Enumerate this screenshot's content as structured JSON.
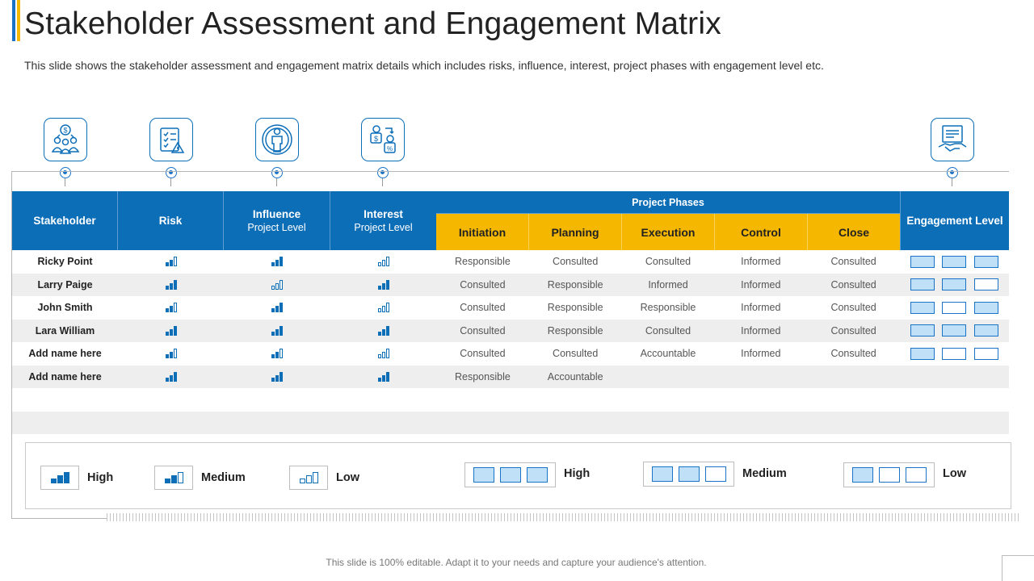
{
  "title": "Stakeholder Assessment and Engagement Matrix",
  "subtitle": "This slide shows the stakeholder assessment and engagement matrix details which includes risks, influence, interest, project phases with engagement level etc.",
  "colors": {
    "blue": "#0d6eb8",
    "yellow": "#f5b700",
    "light_blue": "#bfe0f6",
    "row_alt": "#eeeeee"
  },
  "icons": [
    "stakeholder-group-icon",
    "risk-checklist-icon",
    "influence-person-icon",
    "interest-exchange-icon",
    "engagement-handshake-icon"
  ],
  "headers": {
    "stakeholder": "Stakeholder",
    "risk": "Risk",
    "influence": "Influence",
    "influence_sub": "Project Level",
    "interest": "Interest",
    "interest_sub": "Project Level",
    "project_phases": "Project Phases",
    "phases": [
      "Initiation",
      "Planning",
      "Execution",
      "Control",
      "Close"
    ],
    "engagement": "Engagement Level"
  },
  "rows": [
    {
      "name": "Ricky Point",
      "risk": "medium",
      "influence": "high",
      "interest": "low",
      "phases": [
        "Responsible",
        "Consulted",
        "Consulted",
        "Informed",
        "Consulted"
      ],
      "engagement": "high"
    },
    {
      "name": "Larry Paige",
      "risk": "high",
      "influence": "low",
      "interest": "high",
      "phases": [
        "Consulted",
        "Responsible",
        "Informed",
        "Informed",
        "Consulted"
      ],
      "engagement": "medium"
    },
    {
      "name": "John Smith",
      "risk": "medium",
      "influence": "high",
      "interest": "low",
      "phases": [
        "Consulted",
        "Responsible",
        "Responsible",
        "Informed",
        "Consulted"
      ],
      "engagement": "high_split"
    },
    {
      "name": "Lara William",
      "risk": "high",
      "influence": "high",
      "interest": "high",
      "phases": [
        "Consulted",
        "Responsible",
        "Consulted",
        "Informed",
        "Consulted"
      ],
      "engagement": "high"
    },
    {
      "name": "Add  name here",
      "risk": "medium",
      "influence": "medium",
      "interest": "low",
      "phases": [
        "Consulted",
        "Consulted",
        "Accountable",
        "Informed",
        "Consulted"
      ],
      "engagement": "low"
    },
    {
      "name": "Add  name here",
      "risk": "high",
      "influence": "high",
      "interest": "high",
      "phases": [
        "Responsible",
        "Accountable",
        "",
        "",
        ""
      ],
      "engagement": "none"
    }
  ],
  "legend": {
    "bars": [
      {
        "level": "high",
        "label": "High"
      },
      {
        "level": "medium",
        "label": "Medium"
      },
      {
        "level": "low",
        "label": "Low"
      }
    ],
    "engagement": [
      {
        "level": "high",
        "label": "High"
      },
      {
        "level": "medium",
        "label": "Medium"
      },
      {
        "level": "low",
        "label": "Low"
      }
    ]
  },
  "footer": "This slide is 100% editable. Adapt it to your needs and capture your audience's attention."
}
